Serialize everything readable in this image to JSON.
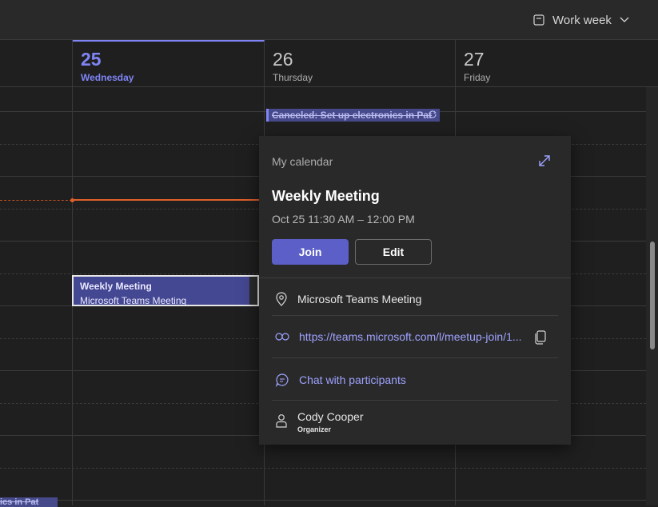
{
  "toolbar": {
    "view_label": "Work week"
  },
  "days": [
    {
      "number": "25",
      "name": "Wednesday",
      "today": true
    },
    {
      "number": "26",
      "name": "Thursday"
    },
    {
      "number": "27",
      "name": "Friday"
    }
  ],
  "events": {
    "canceled_title": "Canceled: Set up electronics in Pat",
    "weekly_title": "Weekly Meeting",
    "weekly_subtitle": "Microsoft Teams Meeting",
    "bottom_fragment": "ics in Pat"
  },
  "popup": {
    "calendar_label": "My calendar",
    "title": "Weekly Meeting",
    "time": "Oct 25 11:30 AM – 12:00 PM",
    "join_label": "Join",
    "edit_label": "Edit",
    "location": "Microsoft Teams Meeting",
    "link": "https://teams.microsoft.com/l/meetup-join/1...",
    "chat_label": "Chat with participants",
    "organizer_name": "Cody Cooper",
    "organizer_role": "Organizer"
  },
  "colors": {
    "accent": "#7f85f5",
    "button_primary": "#5b5fc7",
    "now_line": "#e0602a",
    "background": "#1f1f1f"
  },
  "icons": [
    "calendar-view-icon",
    "chevron-down-icon",
    "expand-icon",
    "location-icon",
    "link-icon",
    "copy-icon",
    "chat-icon",
    "person-icon",
    "recurring-icon"
  ]
}
